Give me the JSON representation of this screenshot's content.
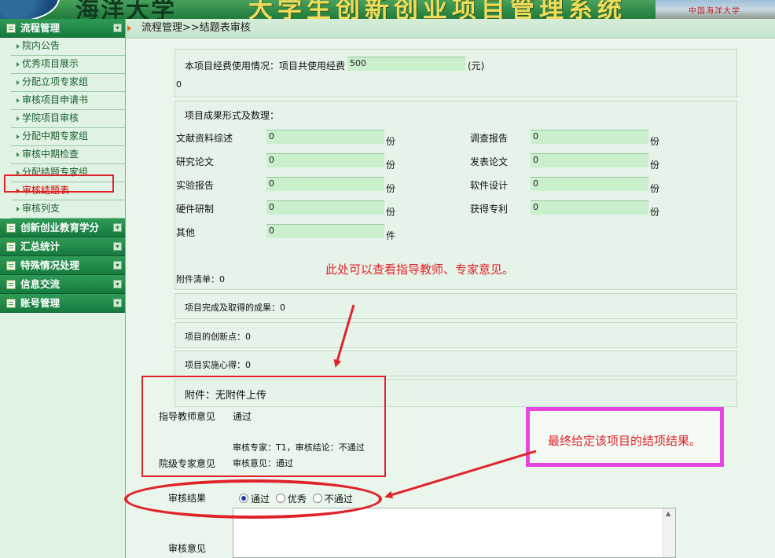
{
  "banner": {
    "brand": "海洋大学",
    "title": "大学生创新创业项目管理系统",
    "photo_caption": "中国海洋大学"
  },
  "breadcrumb": "流程管理>>结题表审核",
  "sidebar": {
    "sections": [
      {
        "label": "流程管理",
        "items": [
          "院内公告",
          "优秀项目展示",
          "分配立项专家组",
          "审核项目申请书",
          "学院项目审核",
          "分配中期专家组",
          "审核中期检查",
          "分配结题专家组",
          "审核结题表",
          "审核列支"
        ]
      },
      {
        "label": "创新创业教育学分",
        "items": []
      },
      {
        "label": "汇总统计",
        "items": []
      },
      {
        "label": "特殊情况处理",
        "items": []
      },
      {
        "label": "信息交流",
        "items": []
      },
      {
        "label": "账号管理",
        "items": []
      }
    ]
  },
  "funding": {
    "label": "本项目经费使用情况：项目共使用经费",
    "value": "500",
    "unit": "(元)",
    "extra": "0"
  },
  "results": {
    "heading": "项目成果形式及数理：",
    "rows": [
      {
        "label": "文献资料综述",
        "value": "0",
        "unit": "份"
      },
      {
        "label": "调查报告",
        "value": "0",
        "unit": "份"
      },
      {
        "label": "研究论文",
        "value": "0",
        "unit": "份"
      },
      {
        "label": "发表论文",
        "value": "0",
        "unit": "份"
      },
      {
        "label": "实验报告",
        "value": "0",
        "unit": "份"
      },
      {
        "label": "软件设计",
        "value": "0",
        "unit": "份"
      },
      {
        "label": "硬件研制",
        "value": "0",
        "unit": "份"
      },
      {
        "label": "获得专利",
        "value": "0",
        "unit": "份"
      },
      {
        "label": "其他",
        "value": "0",
        "unit": "件"
      }
    ],
    "attachments_list": "附件清单：0"
  },
  "annotations": {
    "red_note": "此处可以查看指导教师、专家意见。",
    "pink_note": "最终给定该项目的结项结果。"
  },
  "sections": {
    "achievements": "项目完成及取得的成果：0",
    "innovation": "项目的创新点：0",
    "experience": "项目实施心得：0",
    "attachment": "附件：无附件上传"
  },
  "opinions": {
    "advisor_label": "指导教师意见",
    "advisor_value": "通过",
    "expert_line": "审核专家：T1，审核结论：不通过",
    "college_label": "院级专家意见",
    "college_value": "审核意见：通过"
  },
  "review": {
    "result_label": "审核结果",
    "options": [
      "通过",
      "优秀",
      "不通过"
    ],
    "selected": "通过",
    "opinion_label": "审核意见"
  },
  "colors": {
    "annotation_red": "#e0232a",
    "annotation_pink": "#e646e0",
    "nav_green": "#157a3e"
  }
}
